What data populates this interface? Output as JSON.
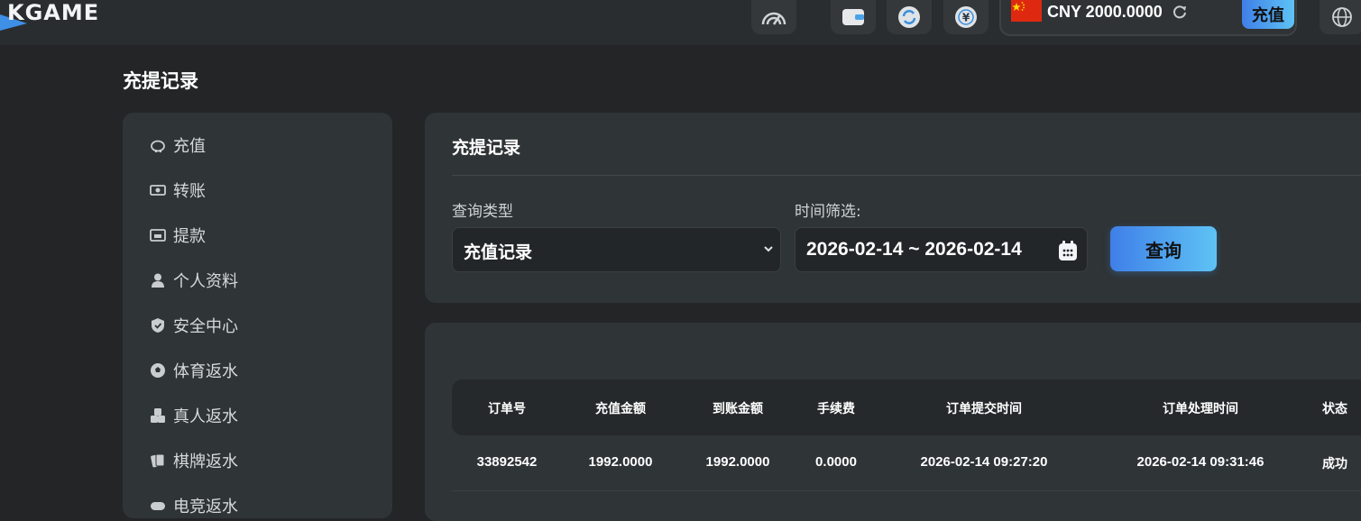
{
  "header": {
    "logo_text": "KGAME",
    "balance_text": "CNY 2000.0000",
    "recharge_label": "充值",
    "icons": [
      "speed-icon",
      "wallet-icon",
      "sync-icon",
      "yen-icon",
      "globe-icon"
    ],
    "accent": "#4a9ef0"
  },
  "page": {
    "title": "充提记录"
  },
  "sidebar": {
    "items": [
      {
        "label": "充值",
        "icon": "piggy-bank-icon"
      },
      {
        "label": "转账",
        "icon": "money-icon"
      },
      {
        "label": "提款",
        "icon": "cash-register-icon"
      },
      {
        "label": "个人资料",
        "icon": "user-icon"
      },
      {
        "label": "安全中心",
        "icon": "shield-icon"
      },
      {
        "label": "体育返水",
        "icon": "soccer-ball-icon"
      },
      {
        "label": "真人返水",
        "icon": "dice-icon"
      },
      {
        "label": "棋牌返水",
        "icon": "cards-icon"
      },
      {
        "label": "电竞返水",
        "icon": "gamepad-icon"
      }
    ]
  },
  "filter": {
    "title": "充提记录",
    "type_label": "查询类型",
    "type_value": "充值记录",
    "time_label": "时间筛选:",
    "date_range": "2026-02-14 ~ 2026-02-14",
    "query_label": "查询"
  },
  "table": {
    "headers": [
      "订单号",
      "充值金额",
      "到账金额",
      "手续费",
      "订单提交时间",
      "订单处理时间",
      "状态"
    ],
    "rows": [
      [
        "33892542",
        "1992.0000",
        "1992.0000",
        "0.0000",
        "2026-02-14 09:27:20",
        "2026-02-14 09:31:46",
        "成功"
      ]
    ]
  }
}
